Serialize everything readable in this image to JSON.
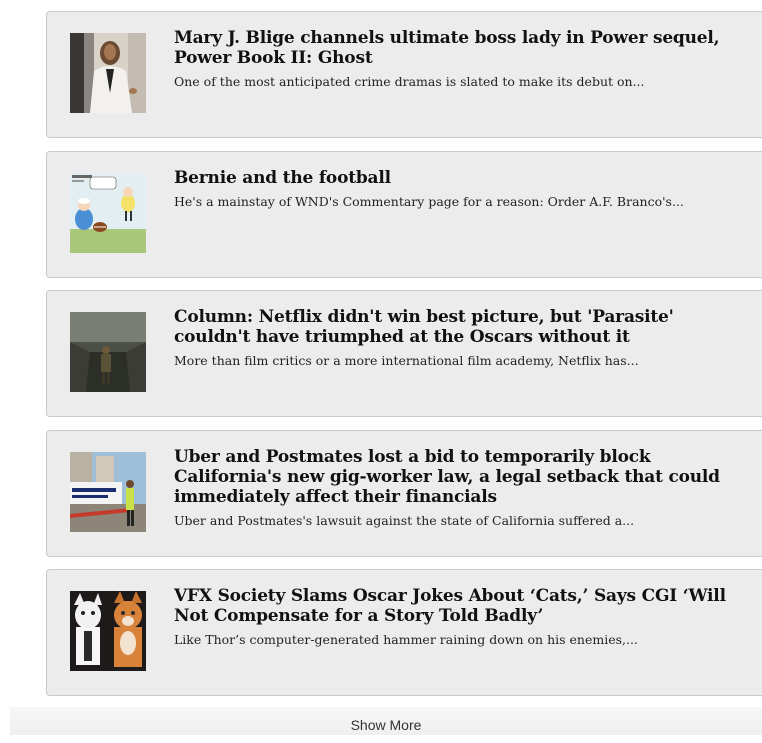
{
  "articles": [
    {
      "title": "Mary J. Blige channels ultimate boss lady in Power sequel, Power Book II: Ghost",
      "summary": "One of the most anticipated crime dramas is slated to make its debut on...",
      "thumbnail_icon": "woman-white-coat-photo"
    },
    {
      "title": "Bernie and the football",
      "summary": "He's a mainstay of WND's Commentary page for a reason: Order A.F. Branco's...",
      "thumbnail_icon": "political-cartoon"
    },
    {
      "title": "Column: Netflix didn't win best picture, but 'Parasite' couldn't have triumphed at the Oscars without it",
      "summary": "More than film critics or a more international film academy, Netflix has...",
      "thumbnail_icon": "soldier-trench-photo"
    },
    {
      "title": "Uber and Postmates lost a bid to temporarily block California's new gig-worker law, a legal setback that could immediately affect their financials",
      "summary": "Uber and Postmates's lawsuit against the state of California suffered a...",
      "thumbnail_icon": "street-protest-photo"
    },
    {
      "title": "VFX Society Slams Oscar Jokes About ‘Cats,’ Says CGI ‘Will Not Compensate for a Story Told Badly’",
      "summary": "Like Thor’s computer-generated hammer raining down on his enemies,...",
      "thumbnail_icon": "cats-costumes-photo"
    }
  ],
  "show_more_label": "Show More"
}
